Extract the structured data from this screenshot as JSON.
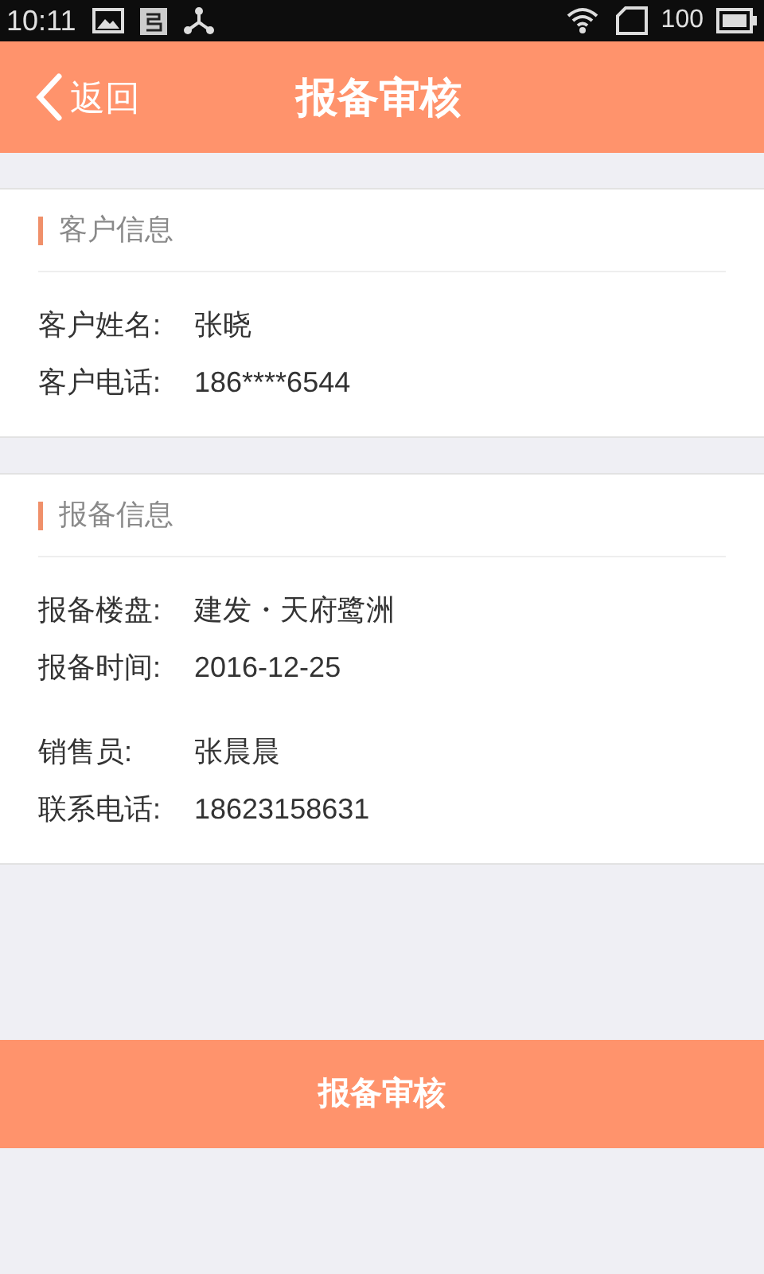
{
  "status_bar": {
    "time": "10:11",
    "battery": "100"
  },
  "header": {
    "back": "返回",
    "title": "报备审核"
  },
  "sections": [
    {
      "title": "客户信息",
      "groups": [
        [
          {
            "label": "客户姓名:",
            "value": "张晓"
          },
          {
            "label": "客户电话:",
            "value": "186****6544"
          }
        ]
      ]
    },
    {
      "title": "报备信息",
      "groups": [
        [
          {
            "label": "报备楼盘:",
            "value": "建发・天府鹭洲"
          },
          {
            "label": "报备时间:",
            "value": "2016-12-25"
          }
        ],
        [
          {
            "label": "销售员:",
            "value": "张晨晨"
          },
          {
            "label": "联系电话:",
            "value": "18623158631"
          }
        ]
      ]
    }
  ],
  "action": "报备审核"
}
